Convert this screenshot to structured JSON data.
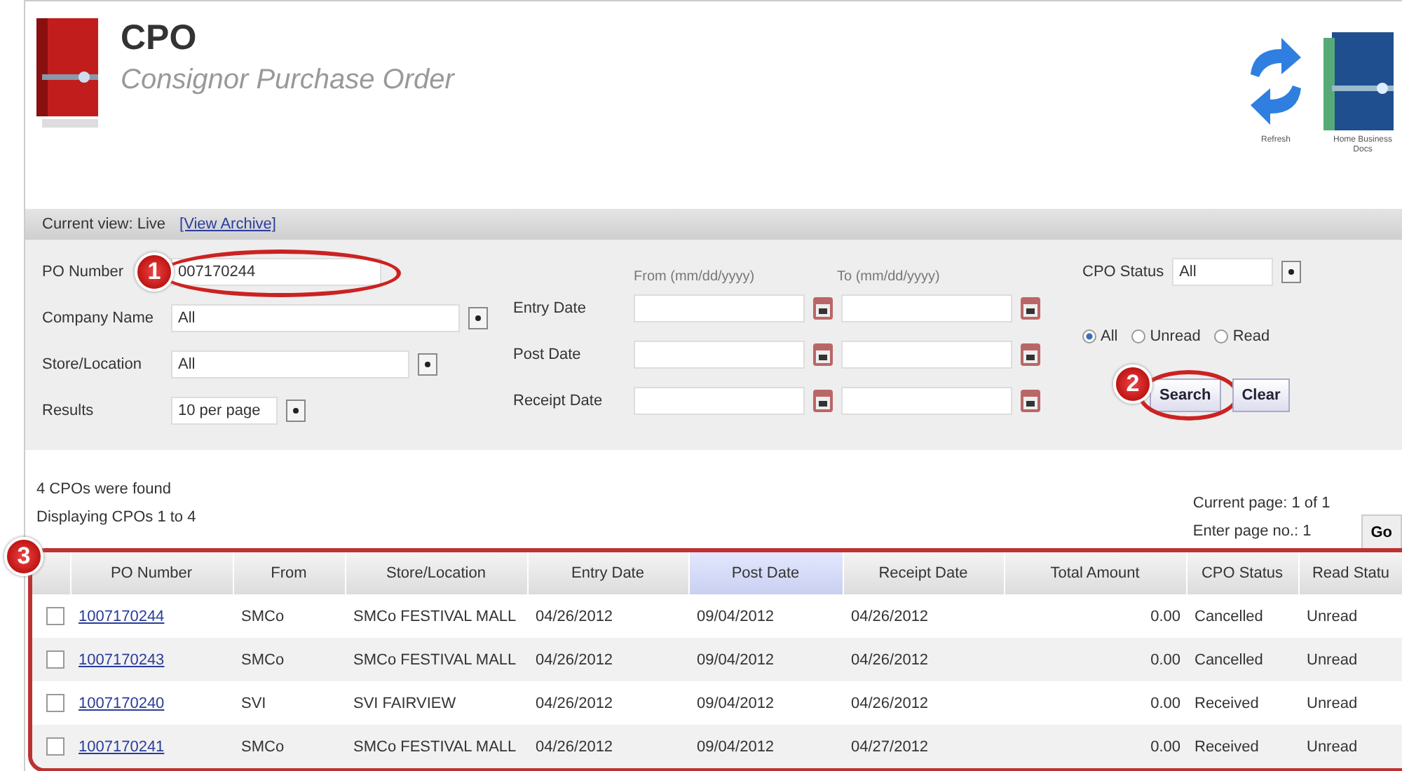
{
  "header": {
    "title": "CPO",
    "subtitle": "Consignor Purchase Order"
  },
  "toolbar": [
    {
      "kind": "refresh",
      "label": "Refresh"
    },
    {
      "kind": "book",
      "label": "Home Business Docs"
    }
  ],
  "view_bar": {
    "label": "Current view: Live",
    "link": "[View Archive]"
  },
  "filters": {
    "po_number": {
      "label": "PO Number",
      "value": "007170244"
    },
    "company_name": {
      "label": "Company Name",
      "value": "All"
    },
    "store_location": {
      "label": "Store/Location",
      "value": "All"
    },
    "results": {
      "label": "Results",
      "value": "10 per page"
    },
    "date_headers": [
      "From (mm/dd/yyyy)",
      "To (mm/dd/yyyy)"
    ],
    "dates": [
      {
        "label": "Entry Date"
      },
      {
        "label": "Post Date"
      },
      {
        "label": "Receipt Date"
      }
    ],
    "cpo_status": {
      "label": "CPO Status",
      "value": "All"
    },
    "read_filter": [
      {
        "label": "All",
        "selected": true
      },
      {
        "label": "Unread",
        "selected": false
      },
      {
        "label": "Read",
        "selected": false
      }
    ],
    "buttons": [
      "Search",
      "Clear"
    ]
  },
  "callouts": [
    "1",
    "2",
    "3"
  ],
  "summary": {
    "found": "4 CPOs were found",
    "displaying": "Displaying CPOs 1 to 4",
    "current_page": "Current page: 1 of 1",
    "enter_page": "Enter page no.: 1",
    "go": "Go"
  },
  "table": {
    "columns": [
      {
        "label": "PO Number",
        "selected": false
      },
      {
        "label": "From",
        "selected": false
      },
      {
        "label": "Store/Location",
        "selected": false
      },
      {
        "label": "Entry Date",
        "selected": false
      },
      {
        "label": "Post Date",
        "selected": true
      },
      {
        "label": "Receipt Date",
        "selected": false
      },
      {
        "label": "Total Amount",
        "selected": false
      },
      {
        "label": "CPO Status",
        "selected": false
      },
      {
        "label": "Read Statu",
        "selected": false
      }
    ],
    "rows": [
      {
        "checked": false,
        "cells": [
          "1007170244",
          "SMCo",
          "SMCo FESTIVAL MALL",
          "04/26/2012",
          "09/04/2012",
          "04/26/2012",
          "0.00",
          "Cancelled",
          "Unread"
        ]
      },
      {
        "checked": false,
        "cells": [
          "1007170243",
          "SMCo",
          "SMCo FESTIVAL MALL",
          "04/26/2012",
          "09/04/2012",
          "04/26/2012",
          "0.00",
          "Cancelled",
          "Unread"
        ]
      },
      {
        "checked": false,
        "cells": [
          "1007170240",
          "SVI",
          "SVI FAIRVIEW",
          "04/26/2012",
          "09/04/2012",
          "04/26/2012",
          "0.00",
          "Received",
          "Unread"
        ]
      },
      {
        "checked": false,
        "cells": [
          "1007170241",
          "SMCo",
          "SMCo FESTIVAL MALL",
          "04/26/2012",
          "09/04/2012",
          "04/27/2012",
          "0.00",
          "Received",
          "Unread"
        ]
      }
    ]
  }
}
